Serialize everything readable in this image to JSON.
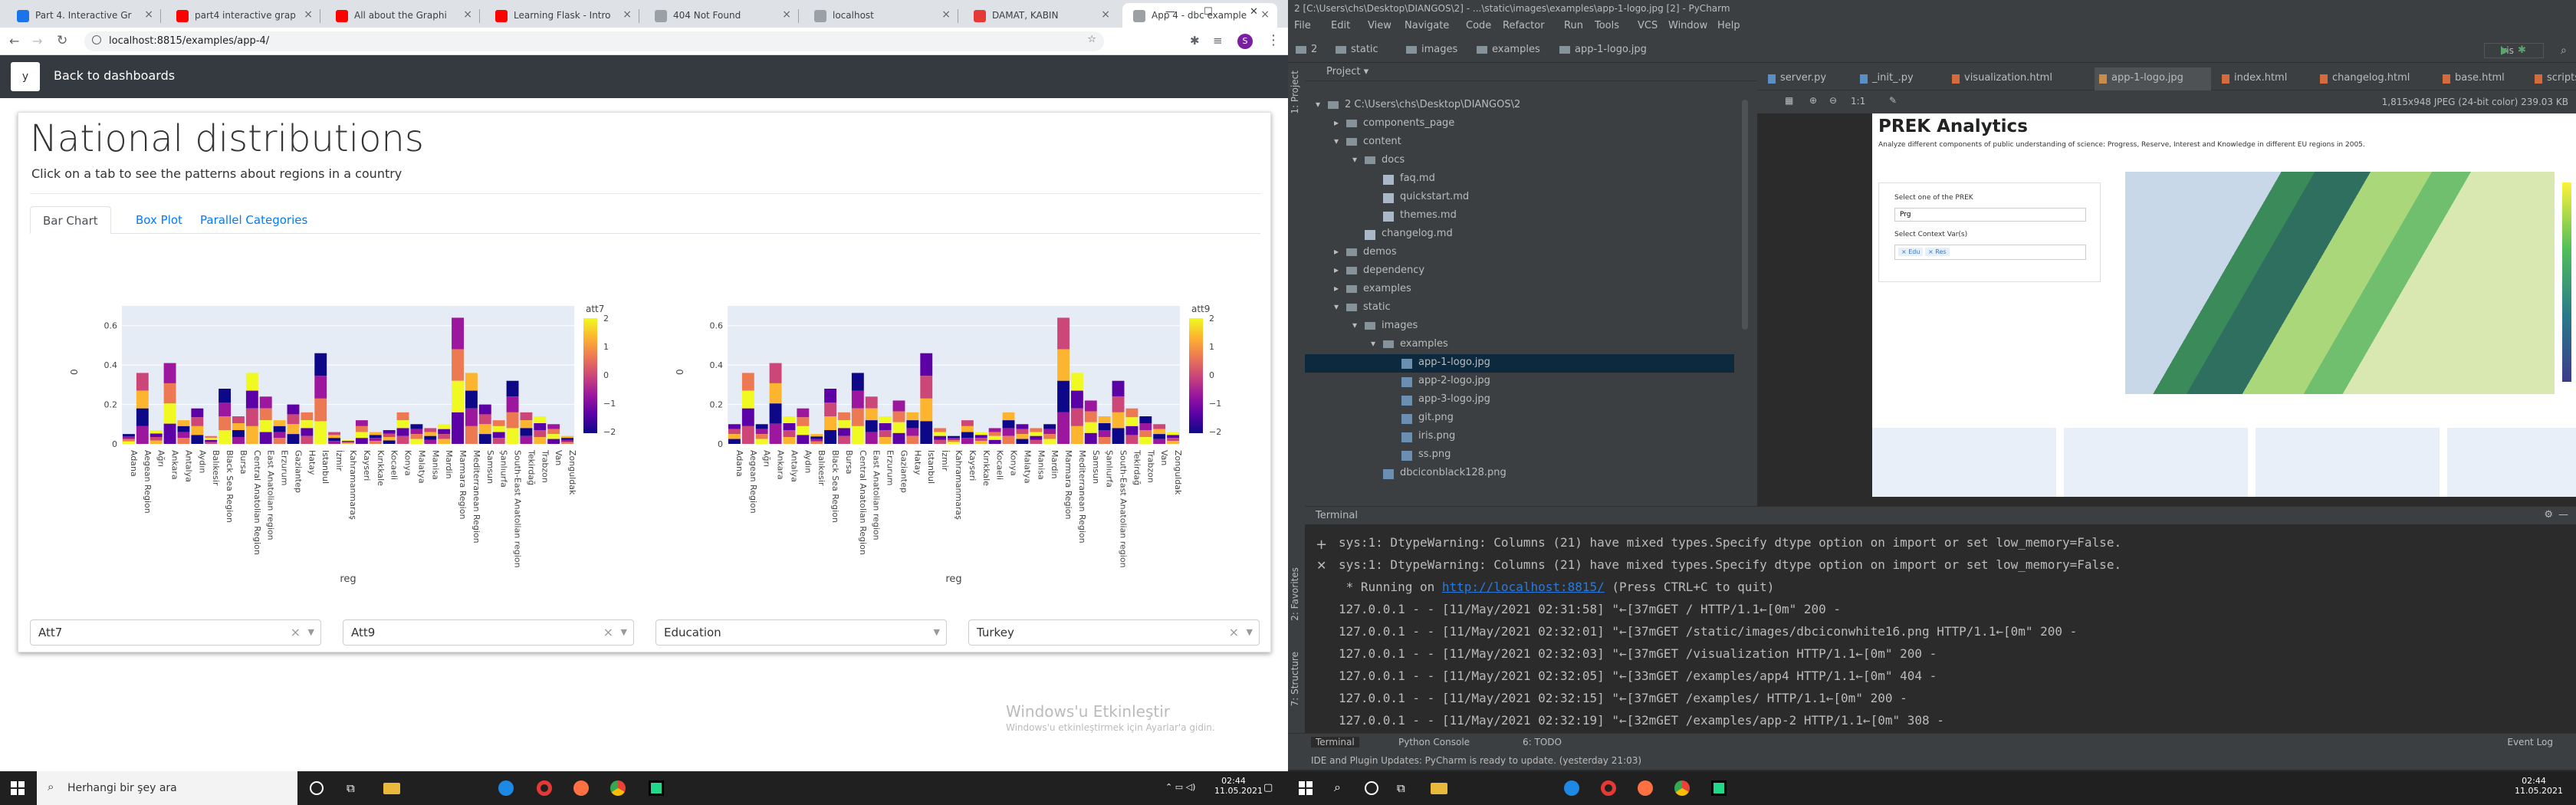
{
  "browser": {
    "tabs": [
      {
        "label": "Part 4. Interactive Gr",
        "color": "#1a73e8"
      },
      {
        "label": "part4 interactive grap",
        "color": "#ff0000"
      },
      {
        "label": "All about the Graphi",
        "color": "#ff0000"
      },
      {
        "label": "Learning Flask - Intro",
        "color": "#ff0000"
      },
      {
        "label": "404 Not Found",
        "color": "#9aa0a6"
      },
      {
        "label": "localhost",
        "color": "#9aa0a6"
      },
      {
        "label": "DAMAT, KABIN",
        "color": "#e53935"
      },
      {
        "label": "App 4 - dbc example",
        "color": "#9aa0a6"
      }
    ],
    "url": "localhost:8815/examples/app-4/",
    "new_tab": "+",
    "win": {
      "min": "—",
      "max": "☐",
      "close": "✕"
    }
  },
  "app": {
    "logo": "y",
    "back": "Back to dashboards",
    "title": "National distributions",
    "subtitle": "Click on a tab to see the patterns about regions in a country",
    "tabs": [
      "Bar Chart",
      "Box Plot",
      "Parallel Categories"
    ],
    "dropdowns": [
      "Att7",
      "Att9",
      "Education",
      "Turkey"
    ],
    "clear": "×",
    "caret": "▼"
  },
  "chart_data": [
    {
      "type": "bar",
      "ylabel": "0",
      "xlabel": "reg",
      "legend_title": "att7",
      "colorbar_ticks": [
        "2",
        "1",
        "0",
        "−1",
        "−2"
      ],
      "ylim": [
        0,
        0.7
      ],
      "y_ticks": [
        "0",
        "0.2",
        "0.4",
        "0.6"
      ],
      "categories": [
        "Adana",
        "Aegean Region",
        "Ağrı",
        "Ankara",
        "Antalya",
        "Aydın",
        "Balıkesir",
        "Black Sea Region",
        "Bursa",
        "Central Anatolian Region",
        "East Anatolian region",
        "Erzurum",
        "Gaziantep",
        "Hatay",
        "Istanbul",
        "İzmir",
        "Kahramanmaraş",
        "Kayseri",
        "Kırıkkale",
        "Kocaeli",
        "Konya",
        "Malatya",
        "Manisa",
        "Mardin",
        "Marmara Region",
        "Mediterranean Region",
        "Samsun",
        "Şanlıurfa",
        "South-East Anatolian region",
        "Tekirdağ",
        "Trabzon",
        "Van",
        "Zonguldak"
      ],
      "values": [
        0.05,
        0.36,
        0.07,
        0.41,
        0.12,
        0.18,
        0.04,
        0.28,
        0.14,
        0.36,
        0.24,
        0.12,
        0.2,
        0.16,
        0.46,
        0.06,
        0.02,
        0.12,
        0.06,
        0.07,
        0.16,
        0.1,
        0.08,
        0.1,
        0.64,
        0.36,
        0.2,
        0.12,
        0.32,
        0.16,
        0.14,
        0.1,
        0.04
      ]
    },
    {
      "type": "bar",
      "ylabel": "0",
      "xlabel": "reg",
      "legend_title": "att9",
      "colorbar_ticks": [
        "2",
        "1",
        "0",
        "−1",
        "−2"
      ],
      "ylim": [
        0,
        0.7
      ],
      "y_ticks": [
        "0",
        "0.2",
        "0.4",
        "0.6"
      ],
      "categories": [
        "Adana",
        "Aegean Region",
        "Ağrı",
        "Ankara",
        "Antalya",
        "Aydın",
        "Balıkesir",
        "Black Sea Region",
        "Bursa",
        "Central Anatolian Region",
        "East Anatolian region",
        "Erzurum",
        "Gaziantep",
        "Hatay",
        "Istanbul",
        "İzmir",
        "Kahramanmaraş",
        "Kayseri",
        "Kırıkkale",
        "Kocaeli",
        "Konya",
        "Malatya",
        "Manisa",
        "Mardin",
        "Marmara Region",
        "Mediterranean Region",
        "Samsun",
        "Şanlıurfa",
        "South-East Anatolian region",
        "Tekirdağ",
        "Trabzon",
        "Van",
        "Zonguldak"
      ],
      "values": [
        0.1,
        0.36,
        0.1,
        0.41,
        0.14,
        0.18,
        0.05,
        0.28,
        0.16,
        0.36,
        0.24,
        0.14,
        0.22,
        0.16,
        0.46,
        0.08,
        0.04,
        0.12,
        0.06,
        0.08,
        0.16,
        0.1,
        0.08,
        0.1,
        0.64,
        0.36,
        0.22,
        0.14,
        0.32,
        0.18,
        0.14,
        0.1,
        0.06
      ]
    }
  ],
  "watermark": {
    "line1": "Windows'u Etkinleştir",
    "line2": "Windows'u etkinleştirmek için Ayarlar'a gidin."
  },
  "taskbar": {
    "search": "Herhangi bir şey ara",
    "time": "02:44",
    "date": "11.05.2021"
  },
  "pycharm": {
    "title": "2 [C:\\Users\\chs\\Desktop\\DIANGOS\\2] - ...\\static\\images\\examples\\app-1-logo.jpg [2] - PyCharm",
    "menu": [
      "File",
      "Edit",
      "View",
      "Navigate",
      "Code",
      "Refactor",
      "Run",
      "Tools",
      "VCS",
      "Window",
      "Help"
    ],
    "breadcrumb": [
      "2",
      "static",
      "images",
      "examples",
      "app-1-logo.jpg"
    ],
    "run_config": "iris",
    "project_label": "Project",
    "editor_tabs": [
      "server.py",
      "_init_.py",
      "visualization.html",
      "app-1-logo.jpg",
      "index.html",
      "changelog.html",
      "base.html",
      "scripts.html"
    ],
    "image_info": "1,815x948 JPEG (24-bit color) 239.03 KB",
    "zoom_label": "1:1",
    "tree": [
      {
        "label": "2  C:\\Users\\chs\\Desktop\\DIANGOS\\2",
        "lvl": 0,
        "kind": "folder",
        "open": true
      },
      {
        "label": "components_page",
        "lvl": 1,
        "kind": "folder",
        "open": false
      },
      {
        "label": "content",
        "lvl": 1,
        "kind": "folder",
        "open": true
      },
      {
        "label": "docs",
        "lvl": 2,
        "kind": "folder",
        "open": true
      },
      {
        "label": "faq.md",
        "lvl": 3,
        "kind": "file"
      },
      {
        "label": "quickstart.md",
        "lvl": 3,
        "kind": "file"
      },
      {
        "label": "themes.md",
        "lvl": 3,
        "kind": "file"
      },
      {
        "label": "changelog.md",
        "lvl": 2,
        "kind": "file"
      },
      {
        "label": "demos",
        "lvl": 1,
        "kind": "folder",
        "open": false
      },
      {
        "label": "dependency",
        "lvl": 1,
        "kind": "folder",
        "open": false
      },
      {
        "label": "examples",
        "lvl": 1,
        "kind": "folder",
        "open": false
      },
      {
        "label": "static",
        "lvl": 1,
        "kind": "folder",
        "open": true
      },
      {
        "label": "images",
        "lvl": 2,
        "kind": "folder",
        "open": true
      },
      {
        "label": "examples",
        "lvl": 3,
        "kind": "folder",
        "open": true
      },
      {
        "label": "app-1-logo.jpg",
        "lvl": 4,
        "kind": "image",
        "selected": true
      },
      {
        "label": "app-2-logo.jpg",
        "lvl": 4,
        "kind": "image"
      },
      {
        "label": "app-3-logo.jpg",
        "lvl": 4,
        "kind": "image"
      },
      {
        "label": "git.png",
        "lvl": 4,
        "kind": "image"
      },
      {
        "label": "iris.png",
        "lvl": 4,
        "kind": "image"
      },
      {
        "label": "ss.png",
        "lvl": 4,
        "kind": "image"
      },
      {
        "label": "dbciconblack128.png",
        "lvl": 3,
        "kind": "image"
      }
    ],
    "preview": {
      "title": "PREK Analytics",
      "subtitle": "Analyze different components of public understanding of science: Progress, Reserve, Interest and Knowledge in different EU regions in 2005.",
      "select_label": "Select one of the PREK",
      "select_value": "Prg",
      "context_label": "Select Context Var(s)",
      "chips": [
        "× Edu",
        "× Res"
      ]
    },
    "terminal_label": "Terminal",
    "terminal": [
      "sys:1: DtypeWarning: Columns (21) have mixed types.Specify dtype option on import or set low_memory=False.",
      "sys:1: DtypeWarning: Columns (21) have mixed types.Specify dtype option on import or set low_memory=False.",
      " * Running on ",
      "127.0.0.1 - - [11/May/2021 02:31:58] \"←[37mGET / HTTP/1.1←[0m\" 200 -",
      "127.0.0.1 - - [11/May/2021 02:32:01] \"←[37mGET /static/images/dbciconwhite16.png HTTP/1.1←[0m\" 200 -",
      "127.0.0.1 - - [11/May/2021 02:32:03] \"←[37mGET /visualization HTTP/1.1←[0m\" 200 -",
      "127.0.0.1 - - [11/May/2021 02:32:05] \"←[33mGET /examples/app4 HTTP/1.1←[0m\" 404 -",
      "127.0.0.1 - - [11/May/2021 02:32:15] \"←[37mGET /examples/ HTTP/1.1←[0m\" 200 -",
      "127.0.0.1 - - [11/May/2021 02:32:19] \"←[32mGET /examples/app-2 HTTP/1.1←[0m\" 308 -"
    ],
    "run_link": "http://localhost:8815/",
    "run_tail": " (Press CTRL+C to quit)",
    "bottom_tabs": [
      "Terminal",
      "Python Console",
      "6: TODO"
    ],
    "event_log": "Event Log",
    "status": "IDE and Plugin Updates: PyCharm is ready to update. (yesterday 21:03)",
    "side_tabs": {
      "project": "1: Project",
      "favorites": "2: Favorites",
      "structure": "7: Structure"
    },
    "taskbar_time": "02:44",
    "taskbar_date": "11.05.2021"
  }
}
